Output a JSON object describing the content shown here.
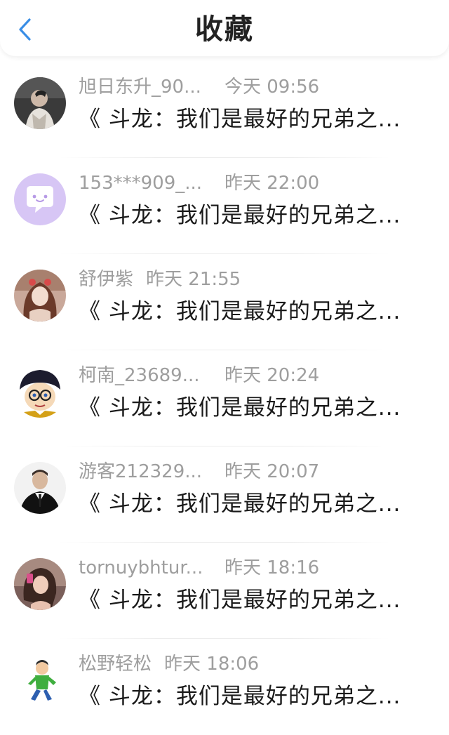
{
  "header": {
    "title": "收藏",
    "back_icon": "chevron-left-icon",
    "accent_color": "#3a8ee6"
  },
  "favorites": [
    {
      "user": "旭日东升_90...",
      "time": "今天 09:56",
      "content": "《 斗龙：我们是最好的兄弟之...",
      "avatar": "portrait-man-avatar"
    },
    {
      "user": "153***909_...",
      "time": "昨天 22:00",
      "content": "《 斗龙：我们是最好的兄弟之...",
      "avatar": "chat-bubble-avatar"
    },
    {
      "user": "舒伊紫",
      "time": "昨天 21:55",
      "content": "《 斗龙：我们是最好的兄弟之...",
      "avatar": "anime-girl-avatar"
    },
    {
      "user": "柯南_23689...",
      "time": "昨天 20:24",
      "content": "《 斗龙：我们是最好的兄弟之...",
      "avatar": "detective-conan-avatar"
    },
    {
      "user": "游客212329...",
      "time": "昨天 20:07",
      "content": "《 斗龙：我们是最好的兄弟之...",
      "avatar": "man-in-suit-avatar"
    },
    {
      "user": "tornuybhtur...",
      "time": "昨天 18:16",
      "content": "《 斗龙：我们是最好的兄弟之...",
      "avatar": "woman-photo-avatar"
    },
    {
      "user": "松野轻松",
      "time": "昨天 18:06",
      "content": "《 斗龙：我们是最好的兄弟之...",
      "avatar": "running-boy-avatar"
    }
  ]
}
